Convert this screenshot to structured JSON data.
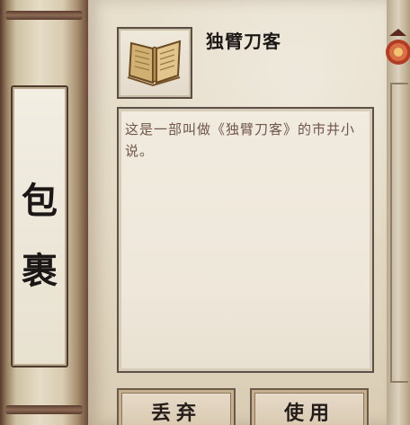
{
  "panel": {
    "name_top": "包",
    "name_bottom": "裹"
  },
  "item": {
    "title": "独臂刀客",
    "description": "这是一部叫做《独臂刀客》的市井小说。",
    "icon": "book-icon"
  },
  "actions": {
    "drop_label": "丢弃",
    "use_label": "使用"
  },
  "colors": {
    "parchment": "#e3d9c4",
    "border": "#5d5046",
    "text": "#6e5548"
  }
}
